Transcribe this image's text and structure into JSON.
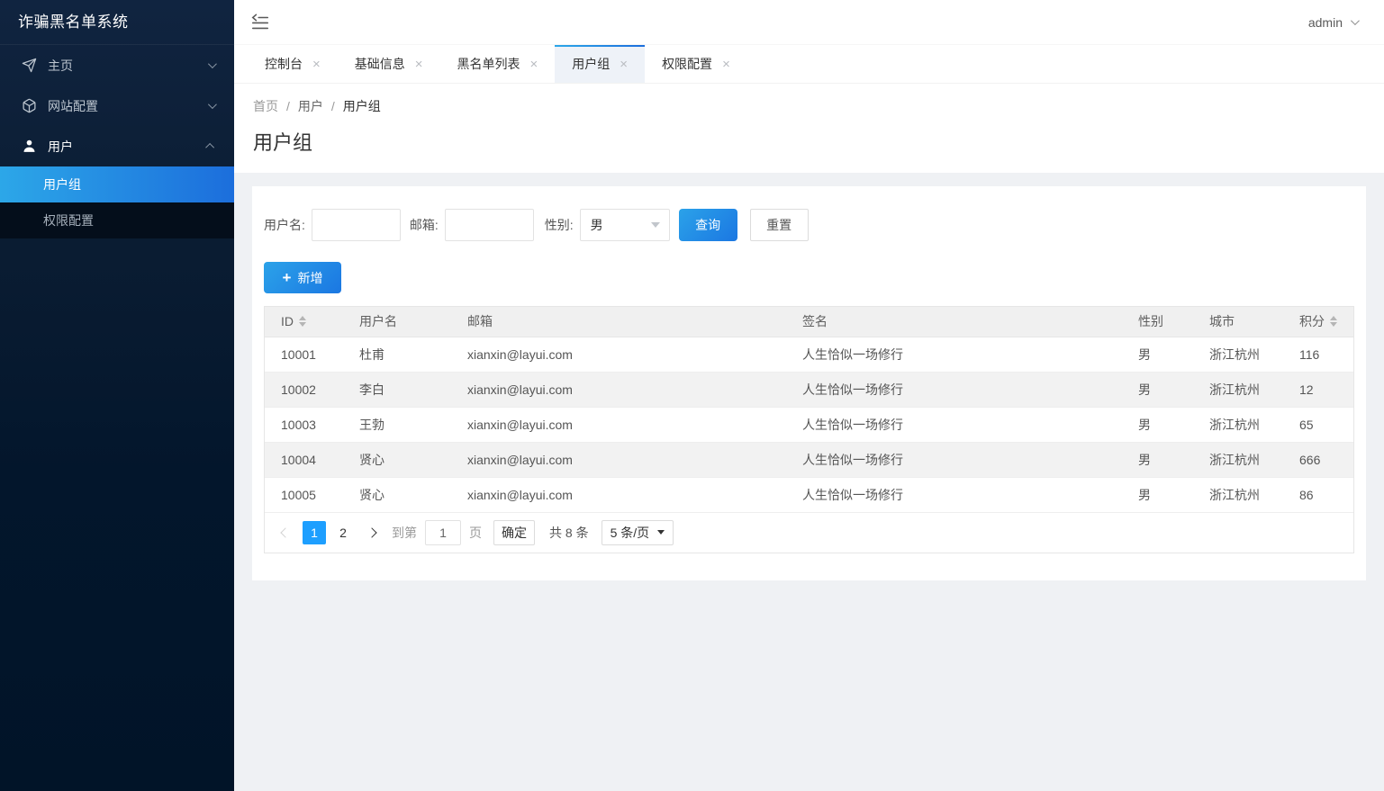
{
  "colors": {
    "accent": "#1e9fff",
    "gradient_start": "#2ca7e8",
    "gradient_end": "#1c6edc",
    "sidebar_top": "#102440",
    "sidebar_bottom": "#011428",
    "content_bg": "#eff1f4"
  },
  "icons": {
    "close": "×",
    "plus": "+"
  },
  "sidebar": {
    "title": "诈骗黑名单系统",
    "items": [
      {
        "icon": "send-icon",
        "label": "主页",
        "expanded": false
      },
      {
        "icon": "cube-icon",
        "label": "网站配置",
        "expanded": false
      },
      {
        "icon": "user-icon",
        "label": "用户",
        "expanded": true
      }
    ],
    "subitems": [
      {
        "label": "用户组",
        "active": true
      },
      {
        "label": "权限配置",
        "active": false
      }
    ]
  },
  "topbar": {
    "user": "admin"
  },
  "tabs": {
    "items": [
      {
        "label": "控制台",
        "active": false
      },
      {
        "label": "基础信息",
        "active": false
      },
      {
        "label": "黑名单列表",
        "active": false
      },
      {
        "label": "用户组",
        "active": true
      },
      {
        "label": "权限配置",
        "active": false
      }
    ]
  },
  "breadcrumb": {
    "sep": "/",
    "items": [
      "首页",
      "用户",
      "用户组"
    ]
  },
  "page": {
    "title": "用户组"
  },
  "filter": {
    "username_label": "用户名:",
    "email_label": "邮箱:",
    "gender_label": "性别:",
    "gender_value": "男",
    "search_label": "查询",
    "reset_label": "重置"
  },
  "toolbar": {
    "add_label": "新增"
  },
  "table": {
    "columns": [
      {
        "label": "ID",
        "sortable": true
      },
      {
        "label": "用户名",
        "sortable": false
      },
      {
        "label": "邮箱",
        "sortable": false
      },
      {
        "label": "签名",
        "sortable": false
      },
      {
        "label": "性别",
        "sortable": false
      },
      {
        "label": "城市",
        "sortable": false
      },
      {
        "label": "积分",
        "sortable": true
      }
    ],
    "rows": [
      [
        "10001",
        "杜甫",
        "xianxin@layui.com",
        "人生恰似一场修行",
        "男",
        "浙江杭州",
        "116"
      ],
      [
        "10002",
        "李白",
        "xianxin@layui.com",
        "人生恰似一场修行",
        "男",
        "浙江杭州",
        "12"
      ],
      [
        "10003",
        "王勃",
        "xianxin@layui.com",
        "人生恰似一场修行",
        "男",
        "浙江杭州",
        "65"
      ],
      [
        "10004",
        "贤心",
        "xianxin@layui.com",
        "人生恰似一场修行",
        "男",
        "浙江杭州",
        "666"
      ],
      [
        "10005",
        "贤心",
        "xianxin@layui.com",
        "人生恰似一场修行",
        "男",
        "浙江杭州",
        "86"
      ]
    ]
  },
  "pagination": {
    "pages": [
      "1",
      "2"
    ],
    "active_page": "1",
    "goto_label": "到第",
    "goto_value": "1",
    "page_unit_label": "页",
    "confirm_label": "确定",
    "total_label": "共 8 条",
    "per_page": "5 条/页"
  }
}
